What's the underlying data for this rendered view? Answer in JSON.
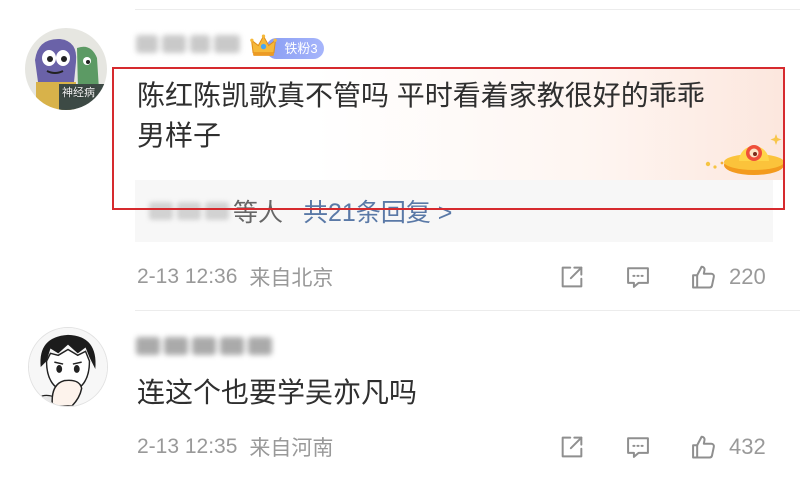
{
  "theme": {
    "text": "#2f2f2f",
    "meta": "#999999",
    "link": "#5a79a7",
    "reply_suffix": "#666666",
    "highlight": "#d62a2e",
    "badge_from": "#8a9ef3",
    "badge_to": "#a6b5fb",
    "divider": "#ececec",
    "reply_bg": "#f7f7f7",
    "icon": "#8f8f8f"
  },
  "icons": {
    "crown": "crown-icon",
    "decoration": "ufo-sticker-icon",
    "share": "share-icon",
    "comment": "comment-icon",
    "like": "like-icon"
  },
  "comments": [
    {
      "avatar_caption": "神经病",
      "badge": "铁粉3",
      "text_lines": [
        "陈红陈凯歌真不管吗 平时看着家教很好的乖乖",
        "男样子"
      ],
      "reply": {
        "suffix": "等人",
        "link": "共21条回复 >"
      },
      "time": "2-13 12:36",
      "source": "来自北京",
      "likes": "220"
    },
    {
      "text_lines": [
        "连这个也要学吴亦凡吗"
      ],
      "time": "2-13 12:35",
      "source": "来自河南",
      "likes": "432"
    }
  ]
}
